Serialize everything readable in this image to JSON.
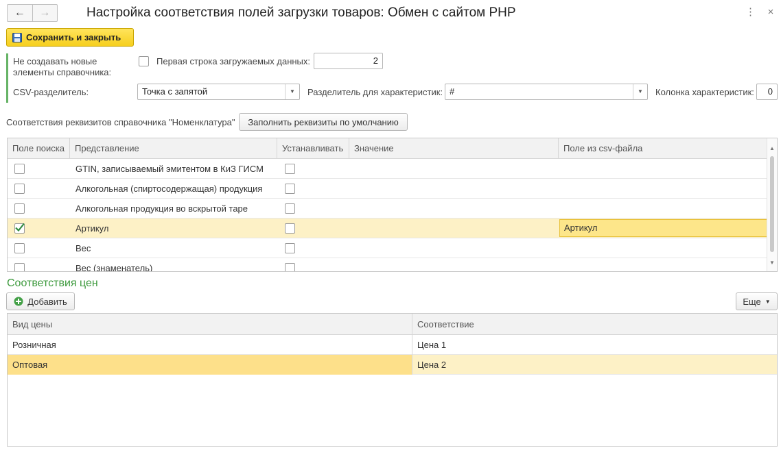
{
  "window": {
    "title": "Настройка соответствия полей загрузки товаров: Обмен с сайтом PHP"
  },
  "toolbar": {
    "save_label": "Сохранить и закрыть"
  },
  "form": {
    "no_create_label": "Не создавать новые\nэлементы справочника:",
    "first_row_label": "Первая строка загружаемых данных:",
    "first_row_value": "2",
    "csv_sep_label": "CSV-разделитель:",
    "csv_sep_value": "Точка с запятой",
    "char_sep_label": "Разделитель для характеристик:",
    "char_sep_value": "#",
    "char_col_label": "Колонка характеристик:",
    "char_col_value": "0"
  },
  "attributes": {
    "label": "Соответствия реквизитов справочника \"Номенклатура\"",
    "fill_default_label": "Заполнить реквизиты по умолчанию",
    "columns": [
      "Поле поиска",
      "Представление",
      "Устанавливать",
      "Значение",
      "Поле из csv-файла"
    ],
    "rows": [
      {
        "search": false,
        "name": "GTIN, записываемый эмитентом в КиЗ ГИСМ",
        "set": false,
        "value": "",
        "csv_field": ""
      },
      {
        "search": false,
        "name": "Алкогольная (спиртосодержащая) продукция",
        "set": false,
        "value": "",
        "csv_field": ""
      },
      {
        "search": false,
        "name": "Алкогольная продукция во вскрытой таре",
        "set": false,
        "value": "",
        "csv_field": ""
      },
      {
        "search": true,
        "name": "Артикул",
        "set": false,
        "value": "",
        "csv_field": "Артикул"
      },
      {
        "search": false,
        "name": "Вес",
        "set": false,
        "value": "",
        "csv_field": ""
      },
      {
        "search": false,
        "name": "Вес (знаменатель)",
        "set": false,
        "value": "",
        "csv_field": ""
      }
    ]
  },
  "prices": {
    "title": "Соответствия цен",
    "add_label": "Добавить",
    "more_label": "Еще",
    "columns": [
      "Вид цены",
      "Соответствие"
    ],
    "rows": [
      {
        "type": "Розничная",
        "match": "Цена 1"
      },
      {
        "type": "Оптовая",
        "match": "Цена 2"
      }
    ]
  },
  "colors": {
    "accent_green": "#3d9a3d",
    "save_yellow": "#f6cf1e",
    "selected_row": "#fdf1c6"
  }
}
